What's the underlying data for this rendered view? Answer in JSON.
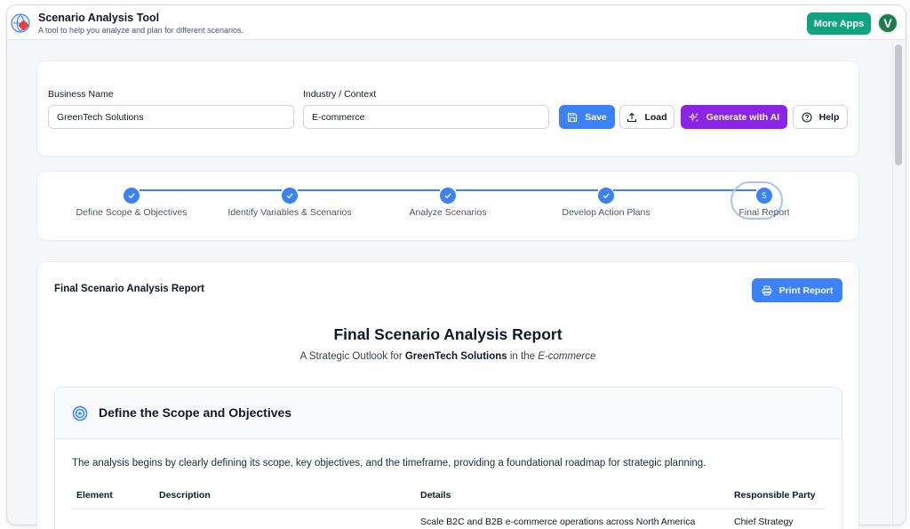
{
  "app": {
    "title": "Scenario Analysis Tool",
    "subtitle": "A tool to help you analyze and plan for different scenarios.",
    "more_apps_label": "More Apps",
    "avatar_initial": "V"
  },
  "form": {
    "business_name_label": "Business Name",
    "business_name_value": "GreenTech Solutions",
    "industry_label": "Industry / Context",
    "industry_value": "E-commerce",
    "save_label": "Save",
    "load_label": "Load",
    "generate_label": "Generate with AI",
    "help_label": "Help"
  },
  "stepper": {
    "steps": [
      {
        "label": "Define Scope & Objectives",
        "status": "complete"
      },
      {
        "label": "Identify Variables & Scenarios",
        "status": "complete"
      },
      {
        "label": "Analyze Scenarios",
        "status": "complete"
      },
      {
        "label": "Develop Action Plans",
        "status": "complete"
      },
      {
        "label": "Final Report",
        "status": "current",
        "number": "5"
      }
    ]
  },
  "report": {
    "card_title": "Final Scenario Analysis Report",
    "print_label": "Print Report",
    "title": "Final Scenario Analysis Report",
    "subtitle_prefix": "A Strategic Outlook for",
    "subtitle_business": "GreenTech Solutions",
    "subtitle_middle": "in the",
    "subtitle_industry": "E-commerce",
    "section": {
      "heading": "Define the Scope and Objectives",
      "intro": "The analysis begins by clearly defining its scope, key objectives, and the timeframe, providing a foundational roadmap for strategic planning.",
      "columns": [
        "Element",
        "Description",
        "Details",
        "Responsible Party"
      ],
      "first_row_partial": {
        "details": "Scale B2C and B2B e-commerce operations across North America",
        "responsible": "Chief Strategy"
      }
    }
  },
  "colors": {
    "primary": "#3b82f6",
    "ai_purple": "#8b24e6",
    "more_apps_green": "#10a37f",
    "avatar_green": "#1f7a4d"
  }
}
